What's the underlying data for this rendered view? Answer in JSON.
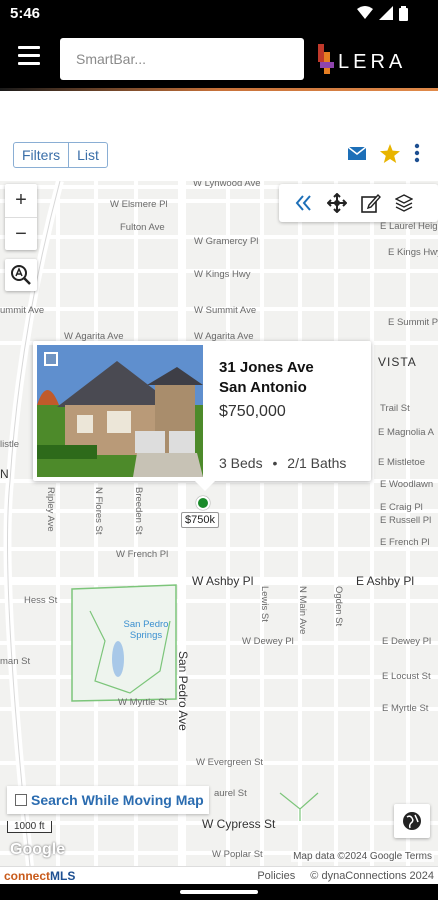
{
  "status": {
    "time": "5:46"
  },
  "header": {
    "search_placeholder": "SmartBar...",
    "logo_text": "LERA"
  },
  "toolbar": {
    "filters_label": "Filters",
    "list_label": "List"
  },
  "map": {
    "streets": {
      "lynwood": "W Lynwood Ave",
      "elsmere": "W Elsmere Pl",
      "fulton": "Fulton Ave",
      "gramercy": "W Gramercy Pl",
      "kings": "W Kings Hwy",
      "summit": "W Summit Ave",
      "agarita": "W Agarita Ave",
      "summit_left": "Summit Ave",
      "summit_right": "E Summit Pl",
      "laurel": "E Laurel Height",
      "kings_e": "E Kings Hwy",
      "vista": "VISTA",
      "trail": "Trail St",
      "magnolia": "E Magnolia A",
      "mistletoe": "E Mistletoe",
      "woodlawn": "E Woodlawn",
      "craig": "E Craig Pl",
      "russell": "E Russell Pl",
      "french_e": "E French Pl",
      "french_w": "W French Pl",
      "ashby_w": "W Ashby Pl",
      "ashby_e": "E Ashby Pl",
      "hess": "Hess St",
      "dewey_w": "W Dewey Pl",
      "dewey_e": "E Dewey Pl",
      "locust": "E Locust St",
      "myrtle_w": "W Myrtle St",
      "myrtle_e": "E Myrtle St",
      "evergreen": "W Evergreen St",
      "cypress": "W Cypress St",
      "poplar": "W Poplar St",
      "laurel_s": "aurel St",
      "ripley": "Ripley Ave",
      "flores": "N Flores St",
      "breeden": "Breeden St",
      "sanpedro": "San Pedro Ave",
      "lewis": "Lewis St",
      "main": "N Main Ave",
      "ogden": "Ogden St",
      "park_name": "San Pedro Springs",
      "man": "man St",
      "n": "N",
      "mistle_left": "listle",
      "summit_avenue": "ummit Ave"
    },
    "popup": {
      "address_line1": "31 Jones Ave",
      "address_line2": "San Antonio",
      "price": "$750,000",
      "beds": "3 Beds",
      "baths": "2/1 Baths"
    },
    "pin_price": "$750k",
    "search_while_moving": "Search While Moving Map",
    "scale_label": "1000 ft",
    "google_label": "Google",
    "attribution": "Map data ©2024 Google   Terms"
  },
  "footer": {
    "brand_connect": "connect",
    "brand_mls": "MLS",
    "policies": "Policies",
    "copyright": "© dynaConnections 2024"
  },
  "colors": {
    "accent_blue": "#2b6cb0",
    "pin_green": "#1a8a2a",
    "star": "#e8b400",
    "park": "#7cc57a"
  }
}
